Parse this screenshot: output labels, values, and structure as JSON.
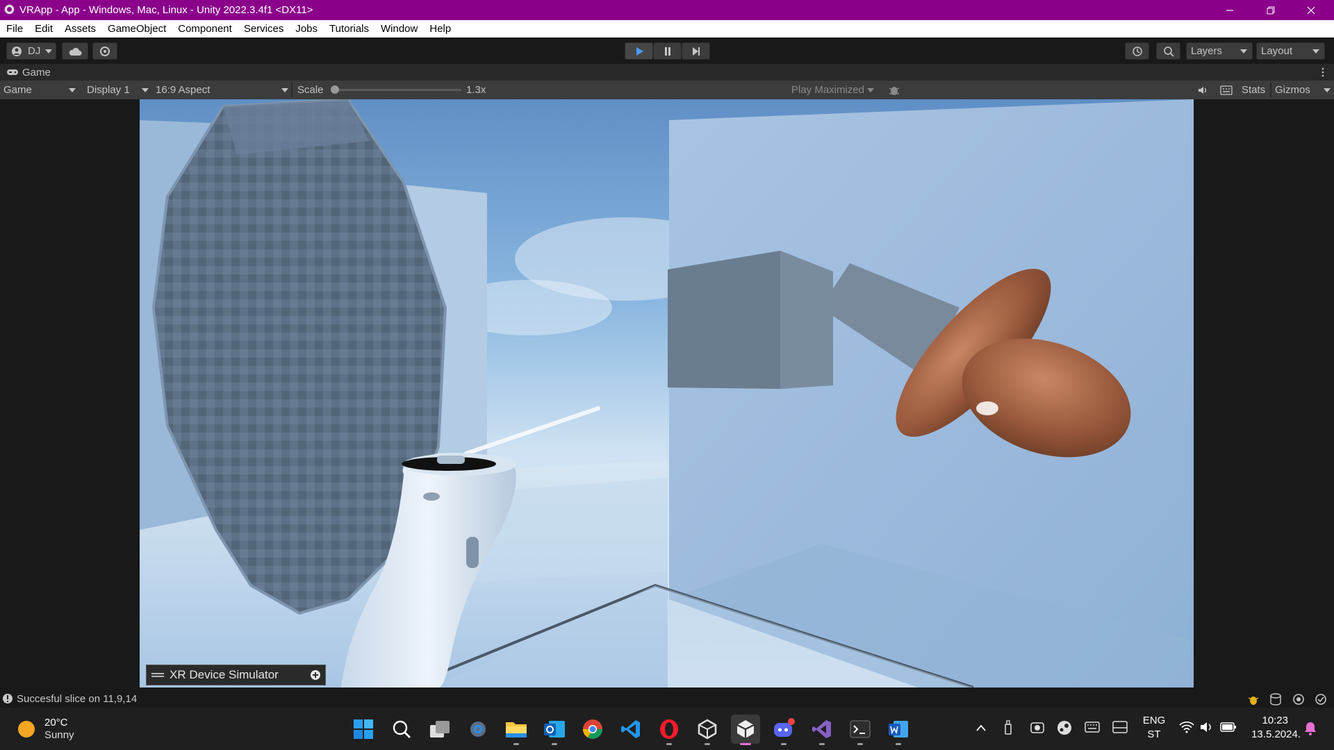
{
  "window": {
    "title": "VRApp - App - Windows, Mac, Linux - Unity 2022.3.4f1 <DX11>",
    "accent": "#8a008a"
  },
  "menu": [
    "File",
    "Edit",
    "Assets",
    "GameObject",
    "Component",
    "Services",
    "Jobs",
    "Tutorials",
    "Window",
    "Help"
  ],
  "toolbar": {
    "account_label": "DJ",
    "layers_label": "Layers",
    "layout_label": "Layout"
  },
  "game_tab": {
    "label": "Game",
    "view_mode": "Game",
    "display": "Display 1",
    "aspect": "16:9 Aspect",
    "scale_label": "Scale",
    "scale_value": "1.3x",
    "play_maximized": "Play Maximized",
    "stats": "Stats",
    "gizmos": "Gizmos"
  },
  "viewport": {
    "xr_panel_label": "XR Device Simulator"
  },
  "status": {
    "message": "Succesful slice on 11,9,14"
  },
  "taskbar": {
    "weather_temp": "20°C",
    "weather_desc": "Sunny",
    "lang": "ENG",
    "lang_sub": "ST",
    "time": "10:23",
    "date": "13.5.2024."
  }
}
